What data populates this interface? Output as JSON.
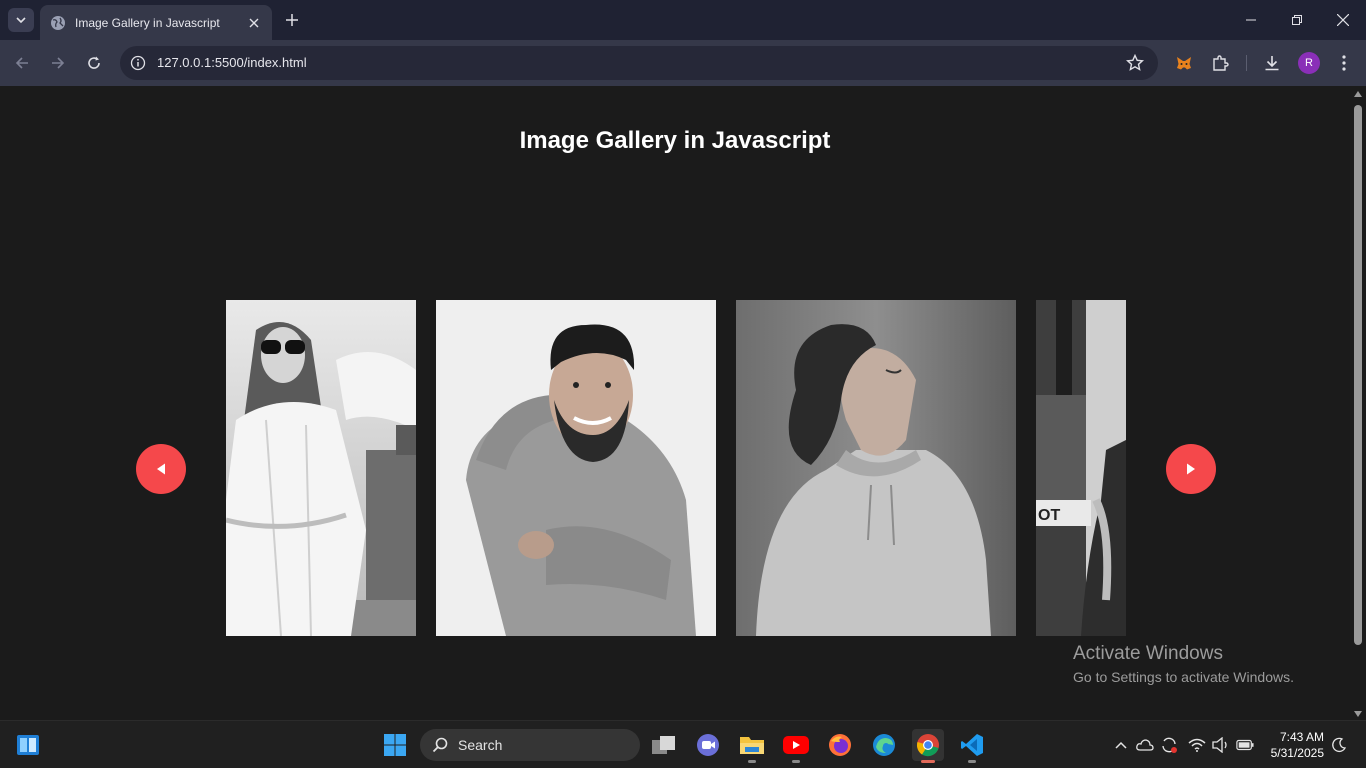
{
  "browser": {
    "tab": {
      "title": "Image Gallery in Javascript",
      "favicon": "globe-icon"
    },
    "address": "127.0.0.1:5500/index.html",
    "profile_initial": "R",
    "colors": {
      "frame": "#1f2233",
      "toolbar": "#353849",
      "omnibox": "#262838",
      "avatar": "#8a2fb8"
    }
  },
  "page": {
    "title": "Image Gallery in Javascript",
    "background": "#1b1b1b",
    "gallery": {
      "photos": [
        {
          "subject": "woman-sunglasses-white-dress"
        },
        {
          "subject": "bearded-man-denim-shirt"
        },
        {
          "subject": "man-hoodie-eyes-closed"
        },
        {
          "subject": "man-street-partial"
        }
      ],
      "prev_icon": "triangle-left-icon",
      "next_icon": "triangle-right-icon",
      "button_color": "#f5484b"
    }
  },
  "watermark": {
    "title": "Activate Windows",
    "subtitle": "Go to Settings to activate Windows."
  },
  "taskbar": {
    "search_label": "Search",
    "apps": [
      "file-manager-icon",
      "meet-icon",
      "file-explorer-icon",
      "youtube-icon",
      "firefox-icon",
      "edge-icon",
      "chrome-icon",
      "vscode-icon"
    ],
    "time": "7:43 AM",
    "date": "5/31/2025"
  }
}
